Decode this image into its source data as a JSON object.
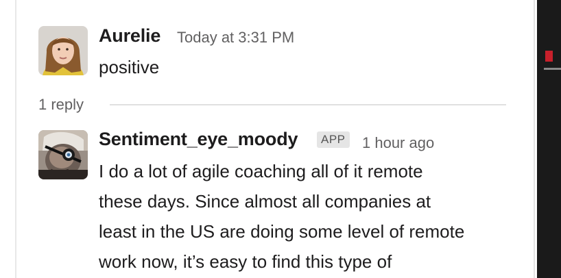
{
  "thread": {
    "parent": {
      "author": "Aurelie",
      "timestamp": "Today at 3:31 PM",
      "text": "positive",
      "avatar_icon": "user-avatar-icon"
    },
    "reply_count_label": "1 reply",
    "reply": {
      "author": "Sentiment_eye_moody",
      "badge": "APP",
      "timestamp": "1 hour ago",
      "text_lines": [
        "I do a lot of agile coaching all of it remote",
        "these days. Since almost all companies at",
        "least in the US are doing some level of remote",
        "work now, it’s easy to find this type of"
      ],
      "avatar_icon": "bot-avatar-icon"
    }
  },
  "colors": {
    "text": "#1d1c1d",
    "muted": "#616061",
    "badge_bg": "#e5e5e5",
    "dark_panel": "#1a1a1a",
    "accent_red": "#c8202b"
  }
}
